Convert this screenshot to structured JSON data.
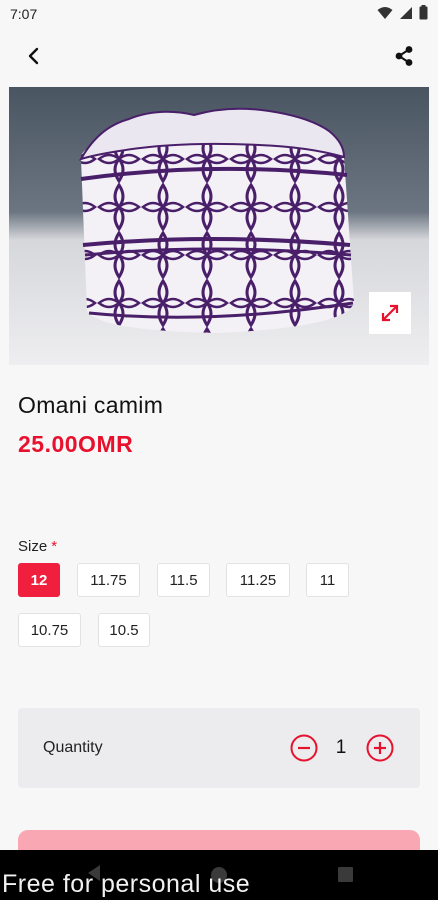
{
  "status_bar": {
    "time": "7:07",
    "icons": [
      "wifi-icon",
      "signal-icon",
      "battery-icon"
    ]
  },
  "app_bar": {
    "back_icon": "back-arrow-icon",
    "share_icon": "share-icon"
  },
  "product": {
    "image_description_icon": "expand-icon",
    "name": "Omani camim",
    "price": "25.00OMR"
  },
  "size": {
    "label": "Size",
    "required_mark": "*",
    "options": [
      "12",
      "11.75",
      "11.5",
      "11.25",
      "11",
      "10.75",
      "10.5"
    ],
    "selected": "12"
  },
  "quantity": {
    "label": "Quantity",
    "value": "1"
  },
  "watermark": "Free for personal use",
  "colors": {
    "accent": "#ef1f3d",
    "price": "#e8112d",
    "cta": "#f8a7b3"
  }
}
